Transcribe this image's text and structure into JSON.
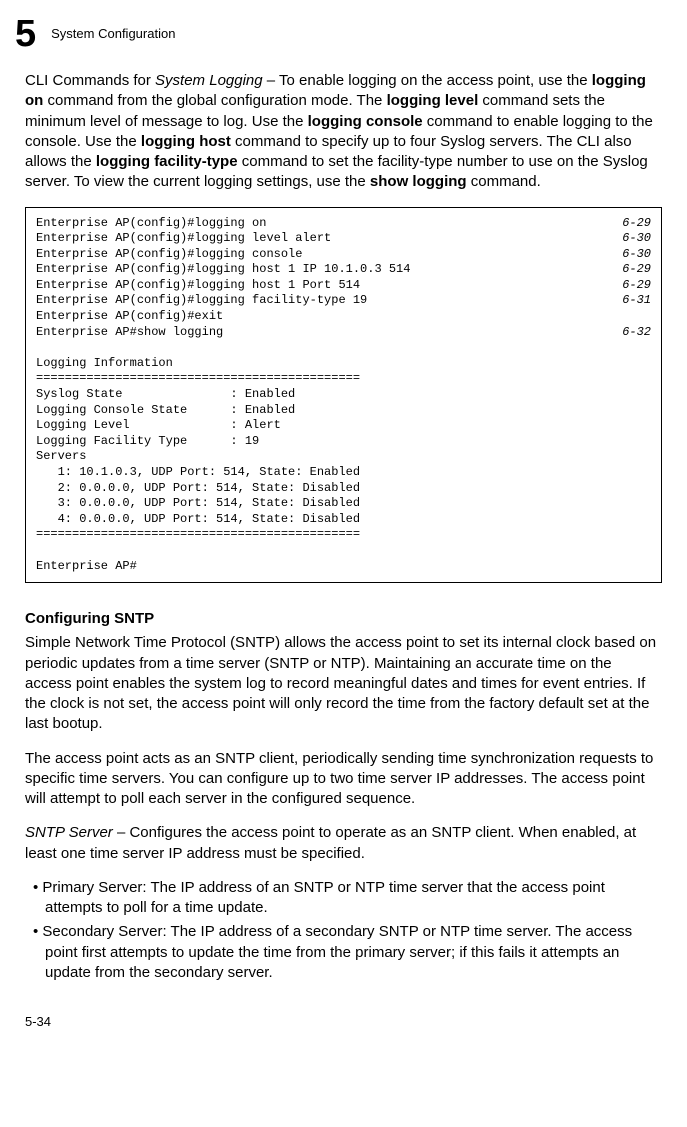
{
  "header": {
    "chapter_num": "5",
    "chapter_title": "System Configuration"
  },
  "p1": {
    "t1": "CLI Commands for ",
    "t2": "System Logging",
    "t3": " – To enable logging on the access point, use the ",
    "t4": "logging on",
    "t5": " command from the global configuration mode. The ",
    "t6": "logging level",
    "t7": " command sets the minimum level of message to log. Use the ",
    "t8": "logging console",
    "t9": " command to enable logging to the console. Use the ",
    "t10": "logging host",
    "t11": " command to specify up to four Syslog servers. The CLI also allows the ",
    "t12": "logging facility-type",
    "t13": " command to set the facility-type number to use on the Syslog server. To view the current logging settings, use the ",
    "t14": "show logging",
    "t15": " command."
  },
  "cli": {
    "r1": {
      "cmd": "Enterprise AP(config)#logging on",
      "ref": "6-29"
    },
    "r2": {
      "cmd": "Enterprise AP(config)#logging level alert",
      "ref": "6-30"
    },
    "r3": {
      "cmd": "Enterprise AP(config)#logging console",
      "ref": "6-30"
    },
    "r4": {
      "cmd": "Enterprise AP(config)#logging host 1 IP 10.1.0.3 514",
      "ref": "6-29"
    },
    "r5": {
      "cmd": "Enterprise AP(config)#logging host 1 Port 514",
      "ref": "6-29"
    },
    "r6": {
      "cmd": "Enterprise AP(config)#logging facility-type 19",
      "ref": "6-31"
    },
    "r7": {
      "cmd": "Enterprise AP(config)#exit",
      "ref": ""
    },
    "r8": {
      "cmd": "Enterprise AP#show logging",
      "ref": "6-32"
    },
    "body": "\nLogging Information\n=============================================\nSyslog State               : Enabled\nLogging Console State      : Enabled\nLogging Level              : Alert\nLogging Facility Type      : 19\nServers\n   1: 10.1.0.3, UDP Port: 514, State: Enabled\n   2: 0.0.0.0, UDP Port: 514, State: Disabled\n   3: 0.0.0.0, UDP Port: 514, State: Disabled\n   4: 0.0.0.0, UDP Port: 514, State: Disabled\n=============================================\n\nEnterprise AP#"
  },
  "section2_title": "Configuring SNTP",
  "p2": "Simple Network Time Protocol (SNTP) allows the access point to set its internal clock based on periodic updates from a time server (SNTP or NTP). Maintaining an accurate time on the access point enables the system log to record meaningful dates and times for event entries. If the clock is not set, the access point will only record the time from the factory default set at the last bootup.",
  "p3": "The access point acts as an SNTP client, periodically sending time synchronization requests to specific time servers. You can configure up to two time server IP addresses. The access point will attempt to poll each server in the configured sequence.",
  "p4": {
    "t1": "SNTP Server",
    "t2": " – Configures the access point to operate as an SNTP client. When enabled, at least one time server IP address must be specified."
  },
  "b1": "• Primary Server: The IP address of an SNTP or NTP time server that the access point attempts to poll for a time update.",
  "b2": "• Secondary Server: The IP address of a secondary SNTP or NTP time server. The access point first attempts to update the time from the primary server; if this fails it attempts an update from the secondary server.",
  "footer": "5-34"
}
